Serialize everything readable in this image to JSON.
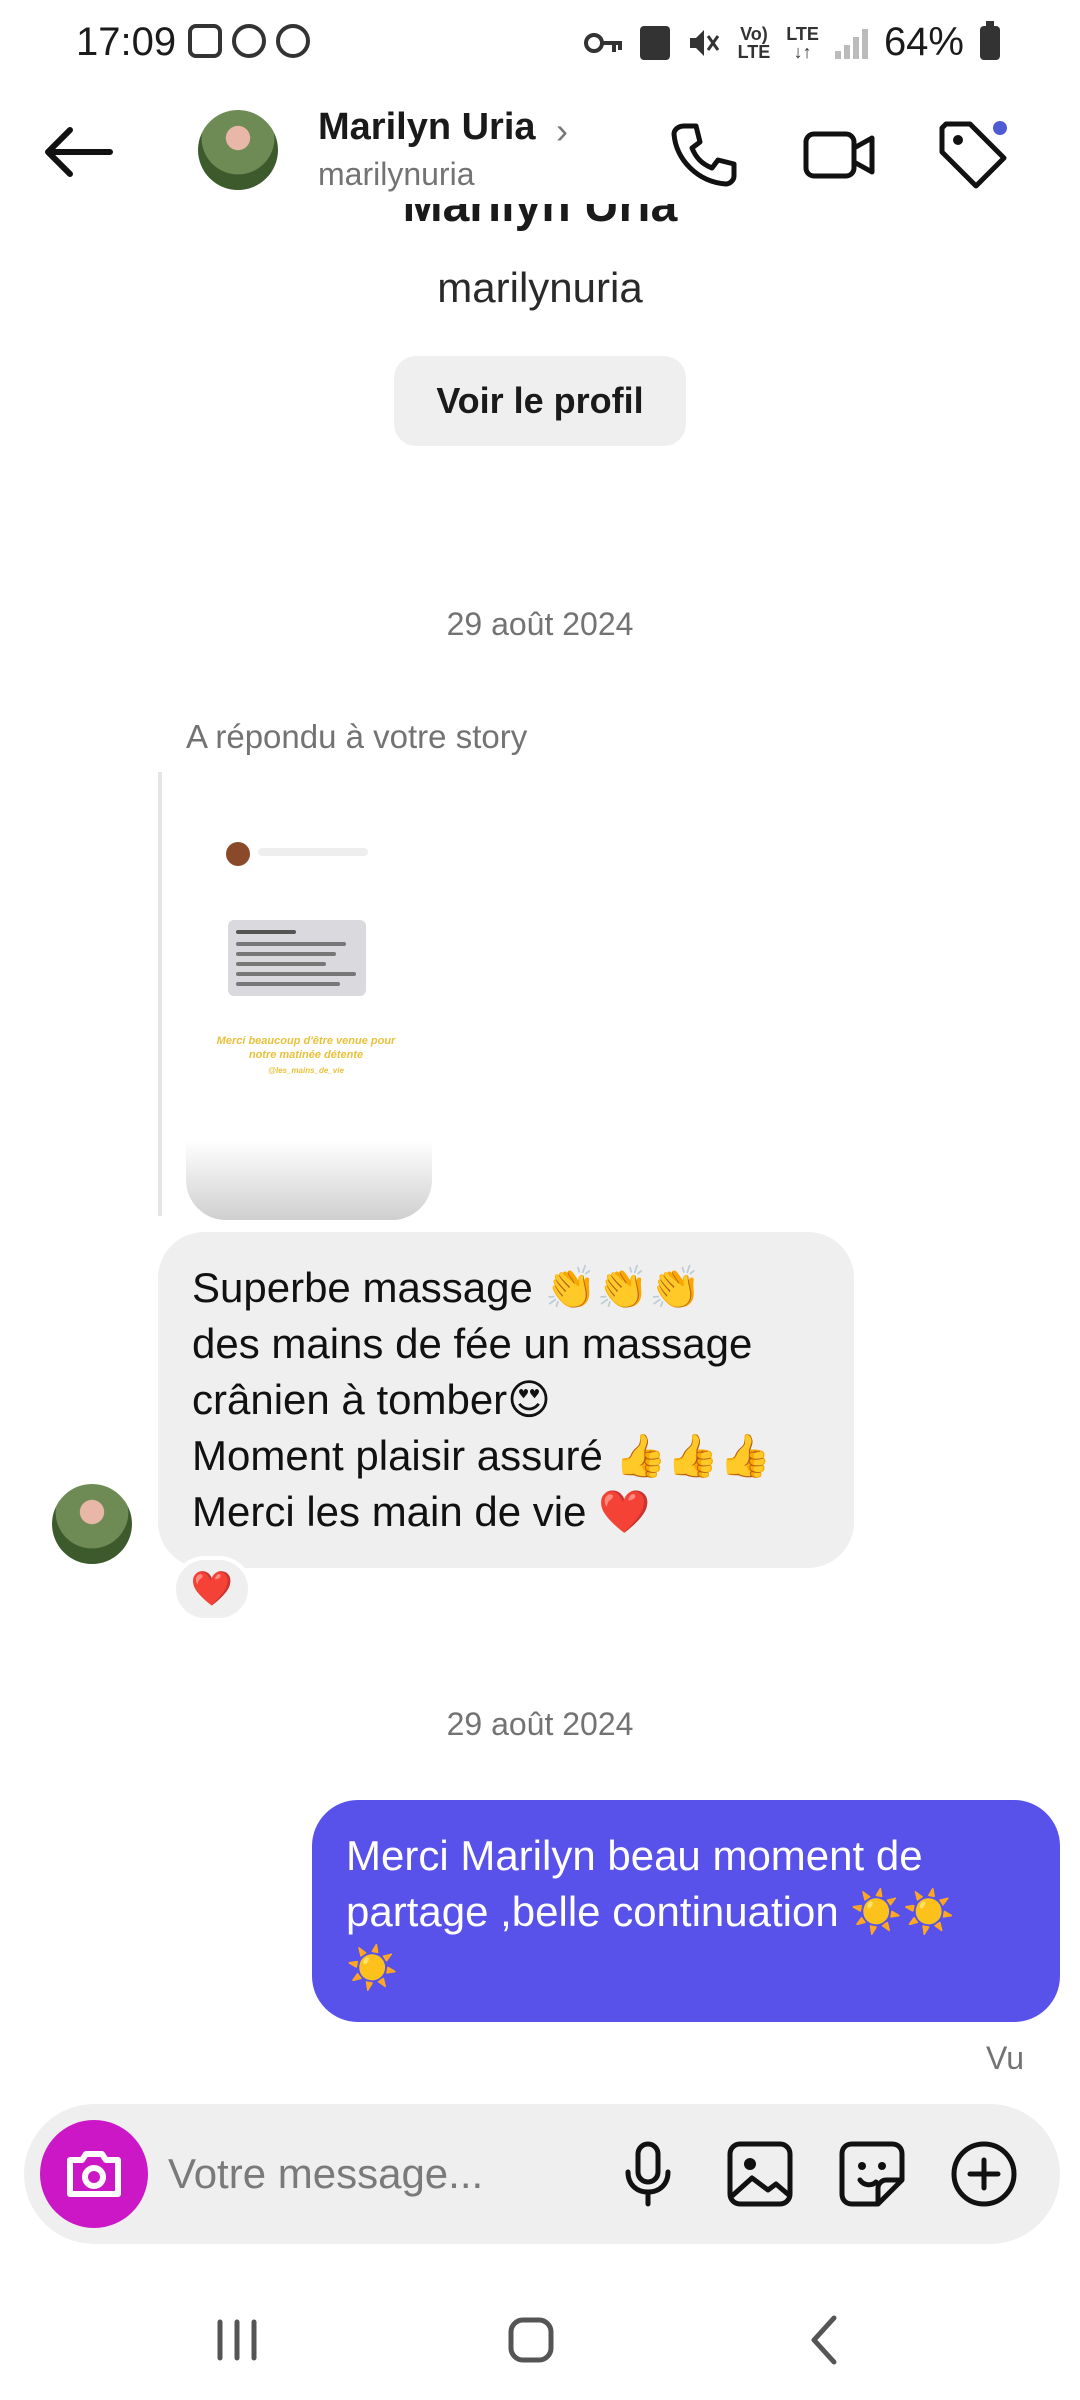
{
  "status_bar": {
    "time": "17:09",
    "lte_top": "Vo)",
    "lte_bottom": "LTE",
    "lte2_top": "LTE",
    "lte2_bottom": "↓↑",
    "battery": "64%"
  },
  "header": {
    "name": "Marilyn Uria",
    "chevron": "›",
    "username": "marilynuria"
  },
  "profile": {
    "name": "Marilyn Uria",
    "username": "marilynuria",
    "view_profile_label": "Voir le profil"
  },
  "conversation": {
    "date_1": "29 août 2024",
    "story_caption": "A répondu à votre story",
    "story_preview": {
      "author": "Malau Laurence",
      "text": "Merci beaucoup d'être venue pour notre matinée détente",
      "handle": "@les_mains_de_vie"
    },
    "incoming_lines": [
      "Superbe massage 👏👏👏",
      "des mains de fée un massage",
      "crânien à tomber😍",
      "Moment plaisir assuré 👍👍👍",
      "Merci les main de vie ❤️"
    ],
    "reaction": "❤️",
    "date_2": "29 août 2024",
    "outgoing_lines": [
      "Merci Marilyn beau moment de",
      "partage ,belle continuation ☀️☀️",
      "☀️"
    ],
    "seen_label": "Vu"
  },
  "composer": {
    "placeholder": "Votre message..."
  }
}
